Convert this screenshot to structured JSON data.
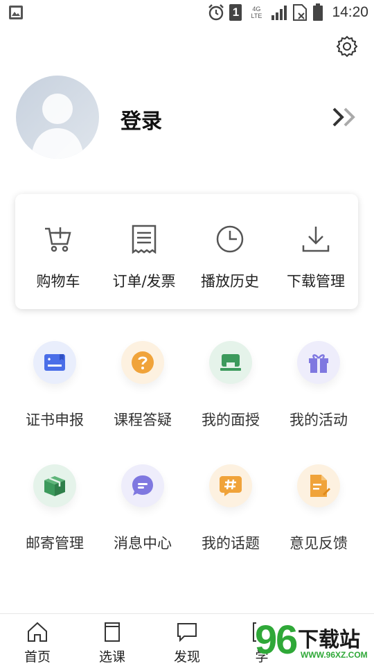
{
  "status_bar": {
    "time": "14:20",
    "network": "4G LTE",
    "sim": "1"
  },
  "profile": {
    "login_label": "登录"
  },
  "quick_actions": [
    {
      "label": "购物车",
      "icon": "cart-icon"
    },
    {
      "label": "订单/发票",
      "icon": "receipt-icon"
    },
    {
      "label": "播放历史",
      "icon": "clock-icon"
    },
    {
      "label": "下载管理",
      "icon": "download-icon"
    }
  ],
  "features": [
    {
      "label": "证书申报",
      "icon": "certificate-icon",
      "color": "#4a6ee8",
      "bg": "#e9eefc"
    },
    {
      "label": "课程答疑",
      "icon": "question-icon",
      "color": "#f0a33a",
      "bg": "#fdf1e0"
    },
    {
      "label": "我的面授",
      "icon": "classroom-icon",
      "color": "#3c9a5c",
      "bg": "#e5f3ea"
    },
    {
      "label": "我的活动",
      "icon": "gift-icon",
      "color": "#7f78e0",
      "bg": "#eeedfb"
    },
    {
      "label": "邮寄管理",
      "icon": "package-icon",
      "color": "#3c9a5c",
      "bg": "#e5f3ea"
    },
    {
      "label": "消息中心",
      "icon": "message-icon",
      "color": "#7f78e0",
      "bg": "#eeedfb"
    },
    {
      "label": "我的话题",
      "icon": "hashtag-icon",
      "color": "#f0a33a",
      "bg": "#fdf1e0"
    },
    {
      "label": "意见反馈",
      "icon": "feedback-icon",
      "color": "#f0a33a",
      "bg": "#fdf1e0"
    }
  ],
  "tabs": [
    {
      "label": "首页",
      "icon": "home-icon"
    },
    {
      "label": "选课",
      "icon": "book-icon"
    },
    {
      "label": "发现",
      "icon": "chat-icon"
    },
    {
      "label": "学",
      "icon": "study-icon"
    }
  ],
  "watermark": {
    "digits_a": "9",
    "digits_b": "6",
    "text": "下载站",
    "url": "WWW.96XZ.COM"
  }
}
